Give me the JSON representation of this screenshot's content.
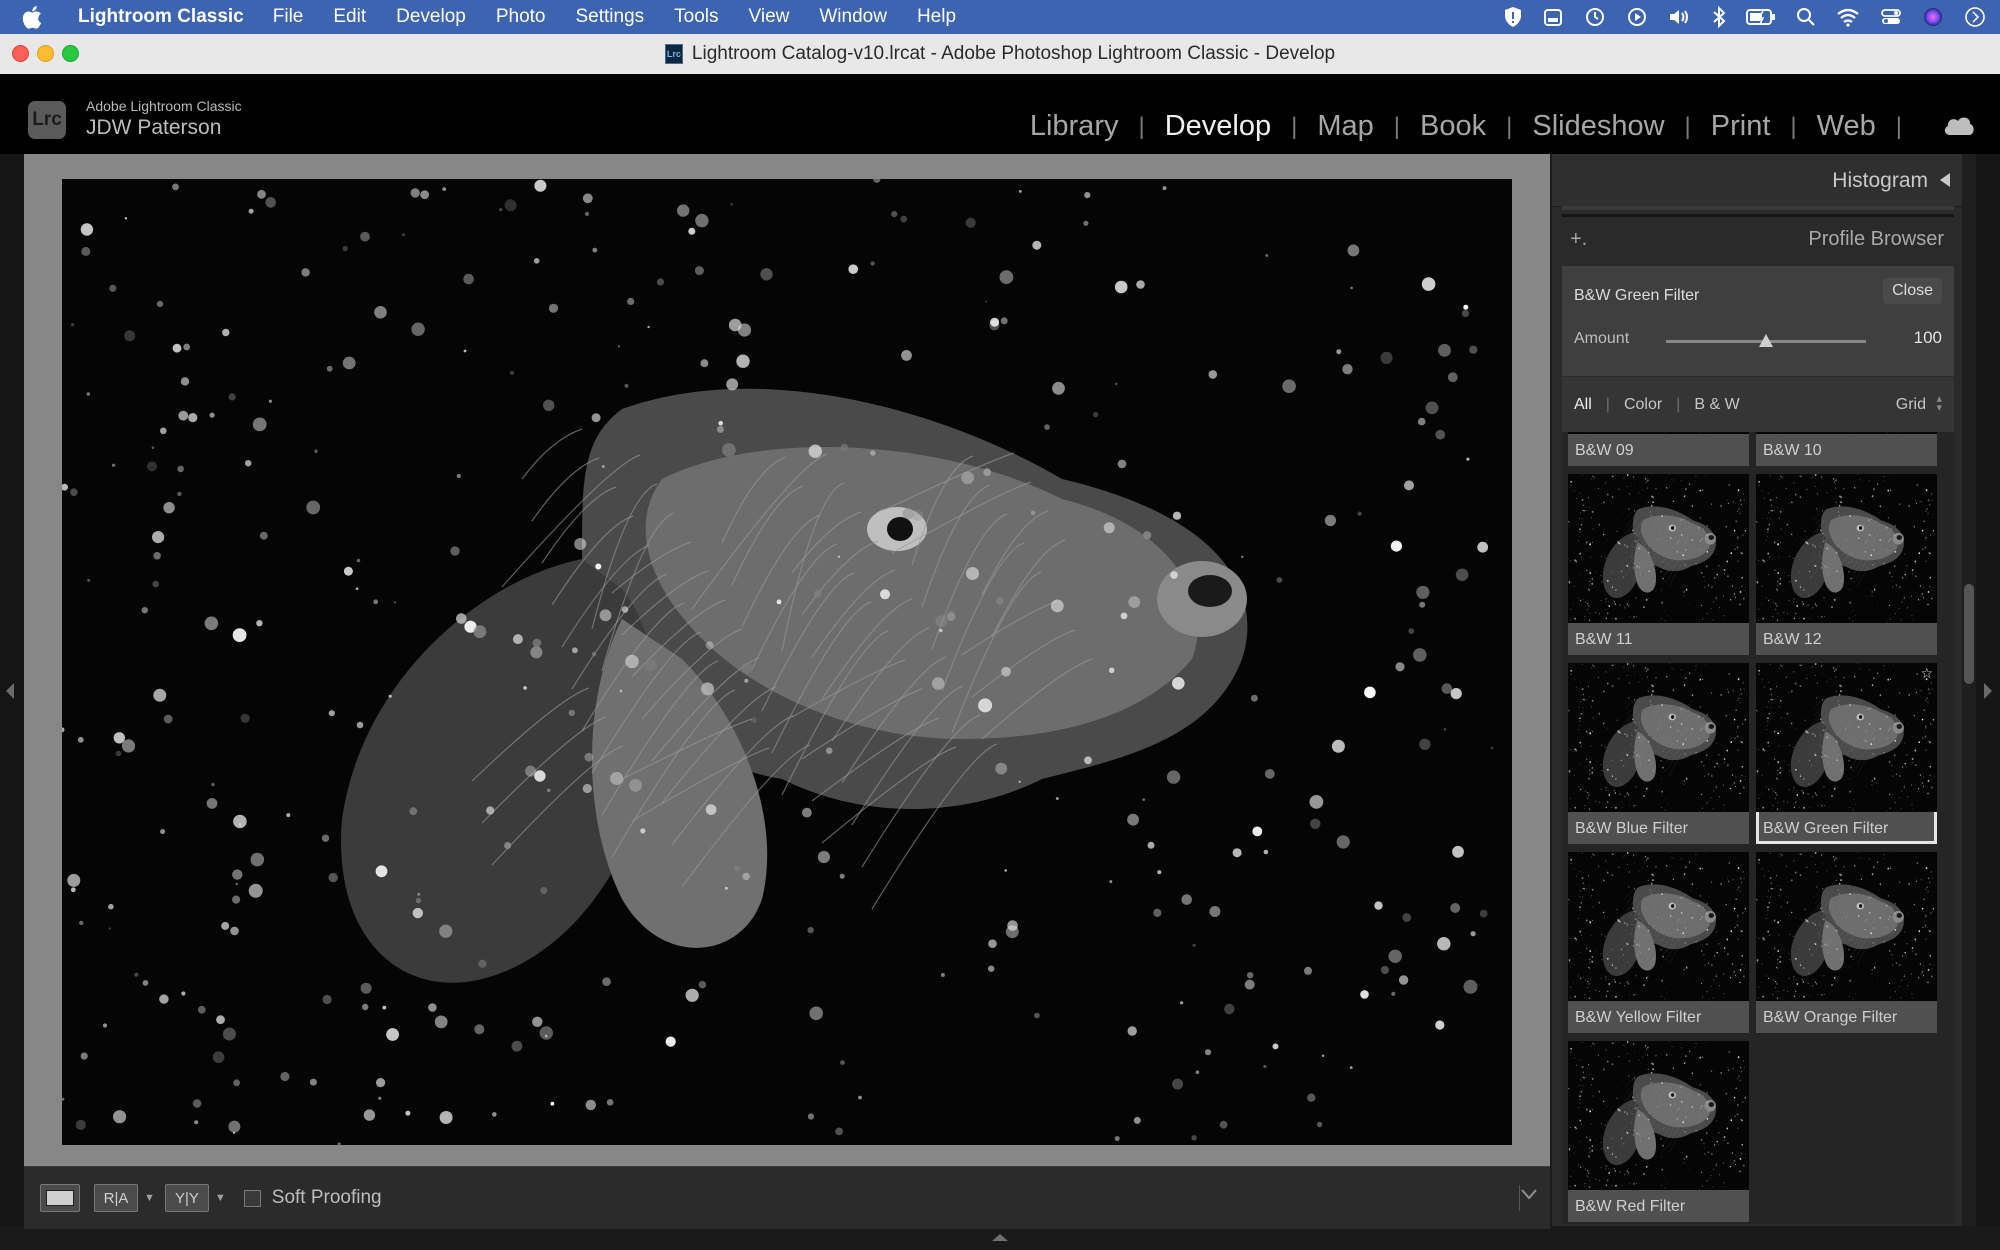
{
  "menubar": {
    "app_name": "Lightroom Classic",
    "items": [
      "File",
      "Edit",
      "Develop",
      "Photo",
      "Settings",
      "Tools",
      "View",
      "Window",
      "Help"
    ]
  },
  "window": {
    "title": "Lightroom Catalog-v10.lrcat - Adobe Photoshop Lightroom Classic - Develop",
    "doc_icon_text": "Lrc"
  },
  "identity": {
    "logo_text": "Lrc",
    "product": "Adobe Lightroom Classic",
    "user": "JDW Paterson"
  },
  "modules": {
    "items": [
      "Library",
      "Develop",
      "Map",
      "Book",
      "Slideshow",
      "Print",
      "Web"
    ],
    "active": "Develop"
  },
  "right_panel": {
    "histogram_title": "Histogram",
    "profile_browser_title": "Profile Browser",
    "add_symbol": "+.",
    "selected_profile": "B&W Green Filter",
    "close_label": "Close",
    "amount_label": "Amount",
    "amount_value": "100",
    "amount_fraction": 0.5,
    "filters": [
      "All",
      "Color",
      "B & W"
    ],
    "active_filter": "All",
    "view_mode": "Grid",
    "profiles": [
      {
        "name": "B&W 09"
      },
      {
        "name": "B&W 10"
      },
      {
        "name": "B&W 11"
      },
      {
        "name": "B&W 12"
      },
      {
        "name": "B&W Blue Filter"
      },
      {
        "name": "B&W Green Filter",
        "selected": true
      },
      {
        "name": "B&W Yellow Filter"
      },
      {
        "name": "B&W Orange Filter"
      },
      {
        "name": "B&W Red Filter"
      }
    ]
  },
  "toolbar": {
    "view_before_after_ra": "R|A",
    "view_before_after_yy": "Y|Y",
    "soft_proofing_label": "Soft Proofing",
    "soft_proofing_checked": false
  },
  "colors": {
    "menubar_bg": "#3d64b0",
    "module_active": "#f0f0f0",
    "module_inactive": "#a6a6a6",
    "viewer_bg": "#878787"
  }
}
